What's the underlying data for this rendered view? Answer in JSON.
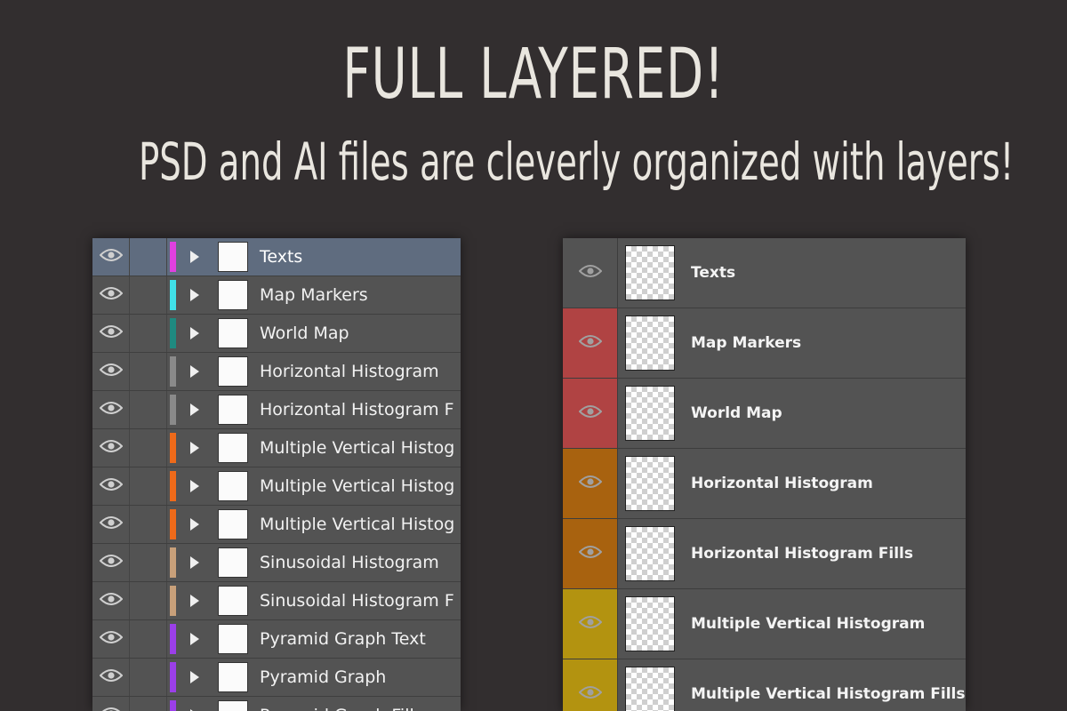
{
  "headline": "FULL LAYERED!",
  "subline": "PSD and AI  files are cleverly organized with layers!",
  "ai_panel": {
    "rows": [
      {
        "label": "Texts",
        "color": "#e040e0",
        "selected": true
      },
      {
        "label": "Map Markers",
        "color": "#40e0e8",
        "selected": false
      },
      {
        "label": "World Map",
        "color": "#1f8a80",
        "selected": false
      },
      {
        "label": "Horizontal Histogram",
        "color": "#8a8a8a",
        "selected": false
      },
      {
        "label": "Horizontal Histogram F",
        "color": "#8a8a8a",
        "selected": false
      },
      {
        "label": "Multiple Vertical Histog",
        "color": "#ee6a1a",
        "selected": false
      },
      {
        "label": "Multiple Vertical Histog",
        "color": "#ee6a1a",
        "selected": false
      },
      {
        "label": "Multiple Vertical Histog",
        "color": "#ee6a1a",
        "selected": false
      },
      {
        "label": "Sinusoidal Histogram",
        "color": "#c8a07a",
        "selected": false
      },
      {
        "label": "Sinusoidal Histogram F",
        "color": "#c8a07a",
        "selected": false
      },
      {
        "label": "Pyramid Graph Text",
        "color": "#9b3fe8",
        "selected": false
      },
      {
        "label": "Pyramid Graph",
        "color": "#9b3fe8",
        "selected": false
      },
      {
        "label": "Pyramid Graph Fills",
        "color": "#9b3fe8",
        "selected": false
      }
    ]
  },
  "ps_panel": {
    "rows": [
      {
        "label": "Texts",
        "eye_bg": "#535353"
      },
      {
        "label": "Map Markers",
        "eye_bg": "#b04343"
      },
      {
        "label": "World Map",
        "eye_bg": "#b04343"
      },
      {
        "label": "Horizontal Histogram",
        "eye_bg": "#a8620f"
      },
      {
        "label": "Horizontal Histogram Fills",
        "eye_bg": "#a8620f"
      },
      {
        "label": "Multiple Vertical Histogram",
        "eye_bg": "#b39310"
      },
      {
        "label": "Multiple Vertical Histogram Fills",
        "eye_bg": "#b39310"
      }
    ]
  },
  "icons": {
    "eye": "eye-icon",
    "disclosure": "disclosure-triangle-icon"
  }
}
